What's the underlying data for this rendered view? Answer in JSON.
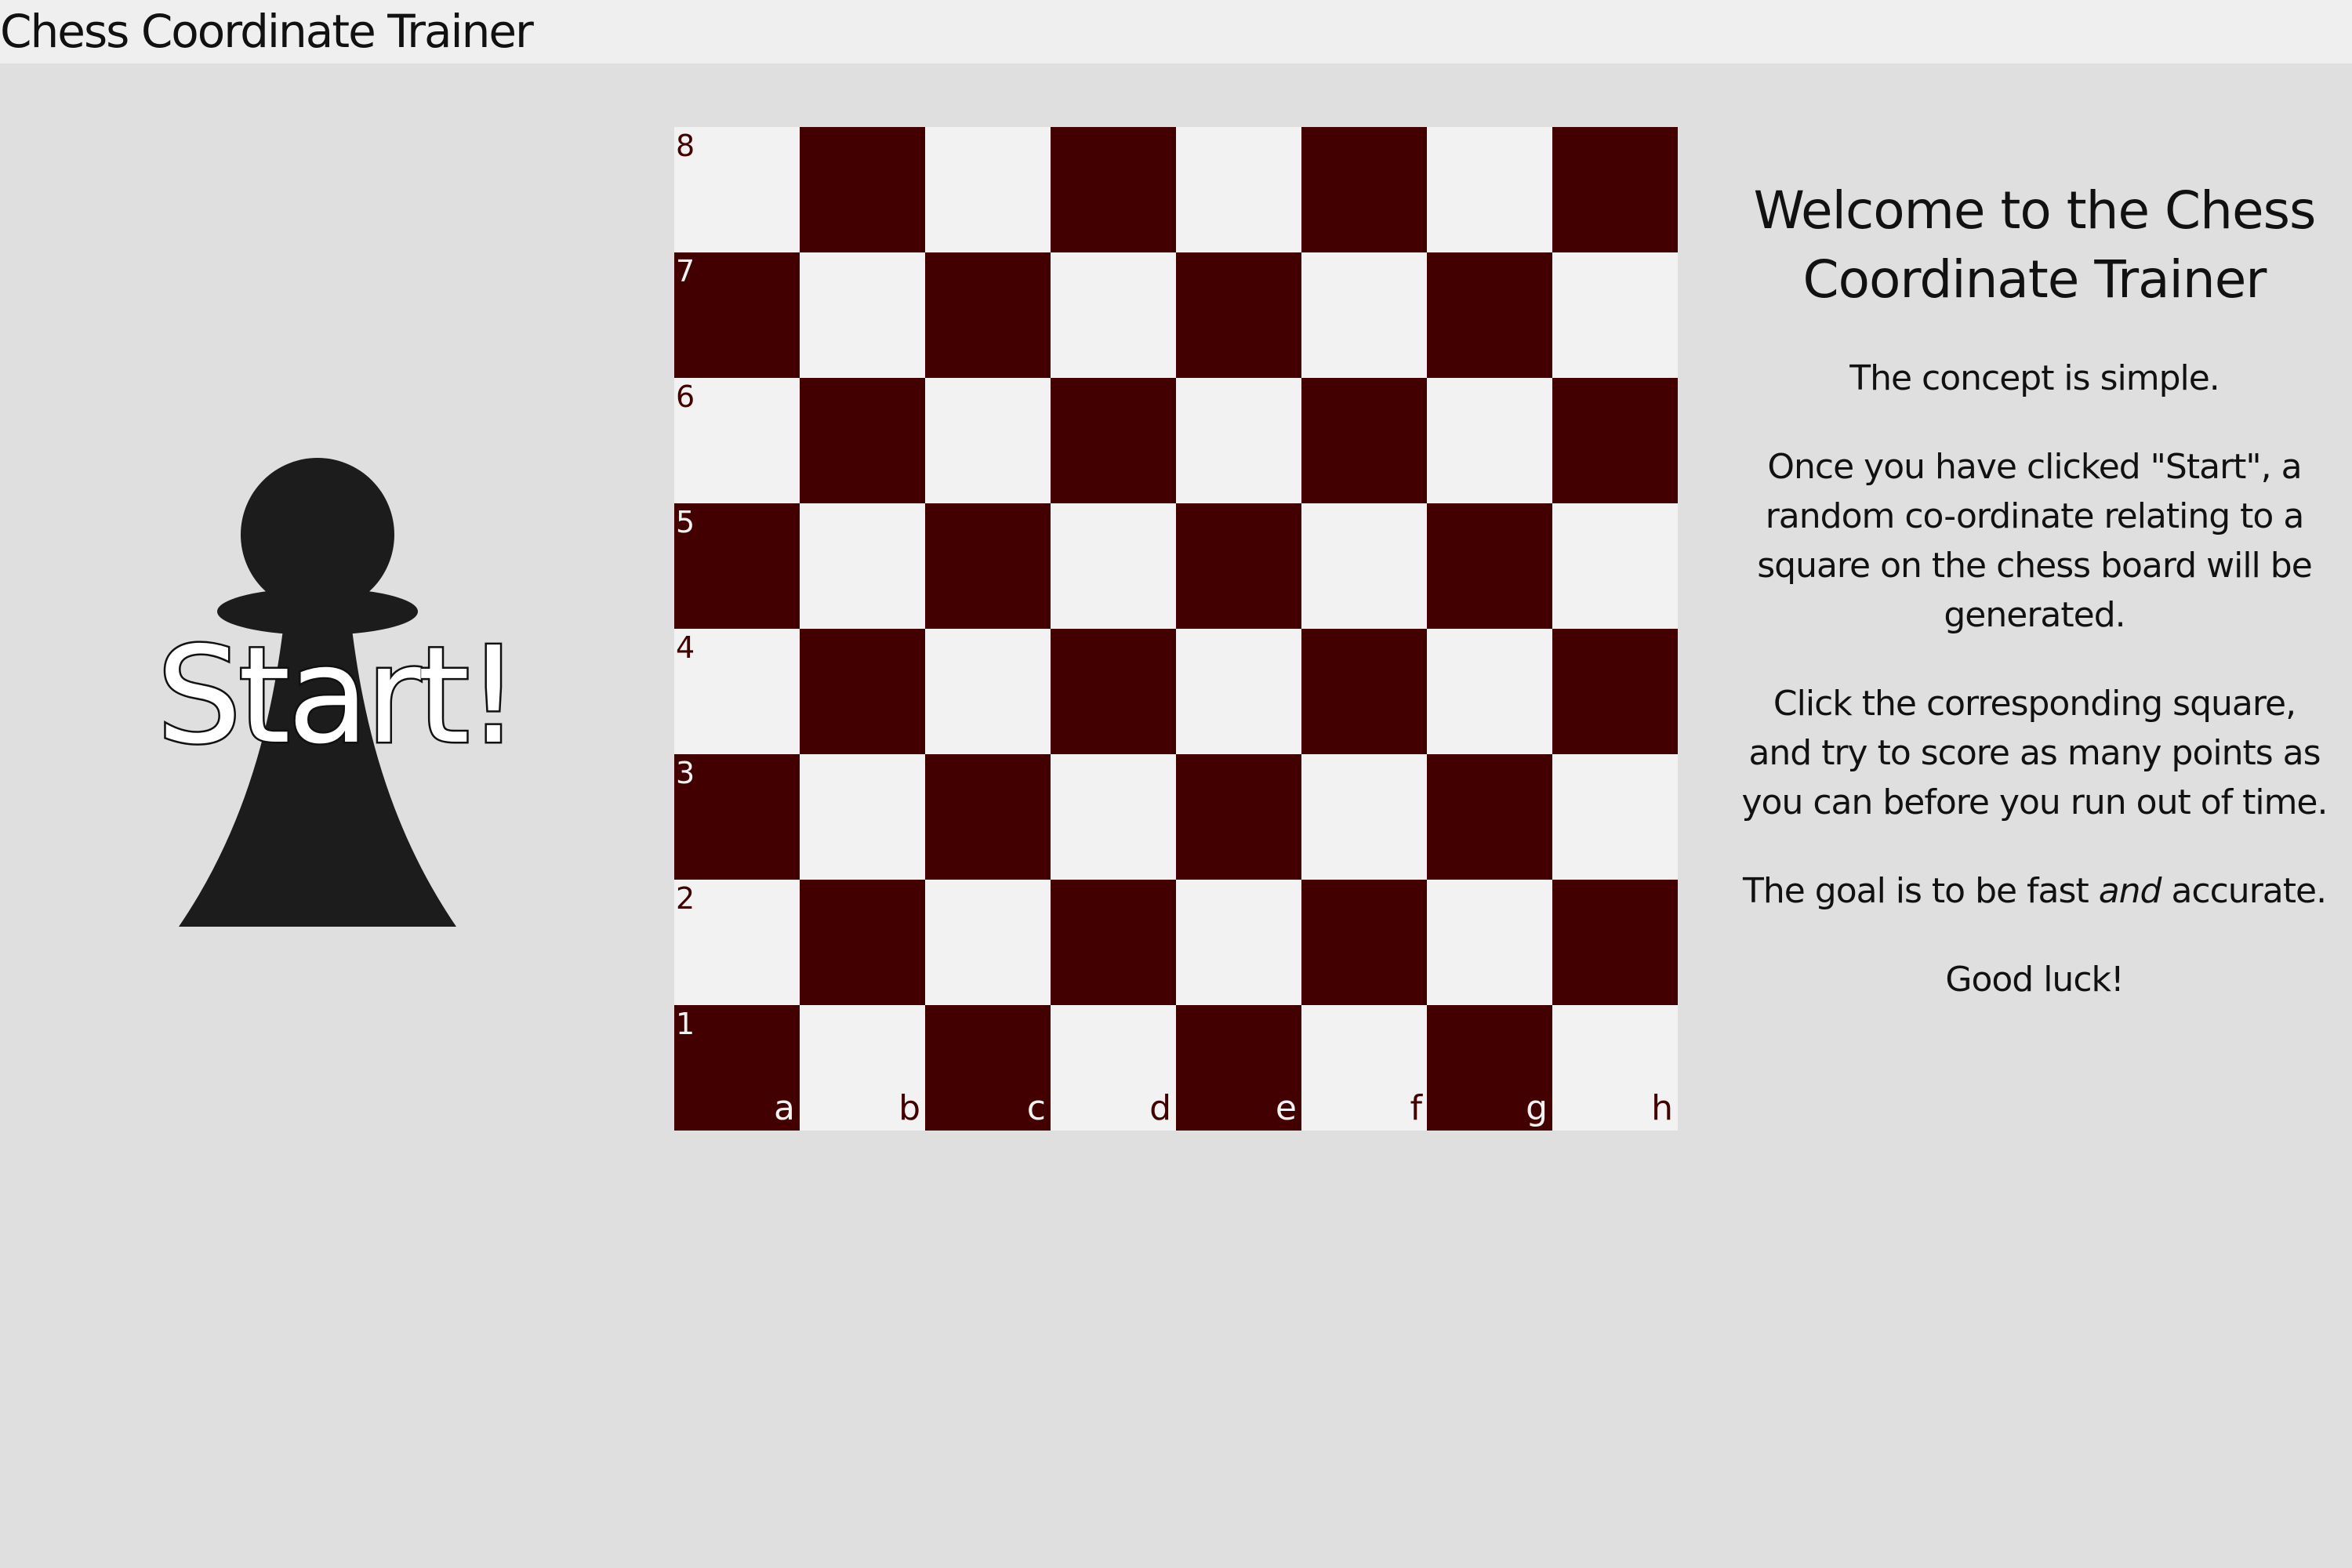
{
  "app": {
    "title": "Chess Coordinate Trainer"
  },
  "start": {
    "label": "Start!",
    "icon": "pawn-icon"
  },
  "board": {
    "ranks": [
      "8",
      "7",
      "6",
      "5",
      "4",
      "3",
      "2",
      "1"
    ],
    "files": [
      "a",
      "b",
      "c",
      "d",
      "e",
      "f",
      "g",
      "h"
    ],
    "colors": {
      "light": "#f2f2f2",
      "dark": "#420000"
    }
  },
  "info": {
    "heading": "Welcome to the Chess Coordinate Trainer",
    "p1": "The concept is simple.",
    "p2": "Once you have clicked \"Start\", a random co-ordinate relating to a square on the chess board will be generated.",
    "p3": "Click the corresponding square, and try to score as many points as you can before you run out of time.",
    "p4_before": "The goal is to be fast ",
    "p4_em": "and",
    "p4_after": " accurate.",
    "p5": "Good luck!"
  }
}
